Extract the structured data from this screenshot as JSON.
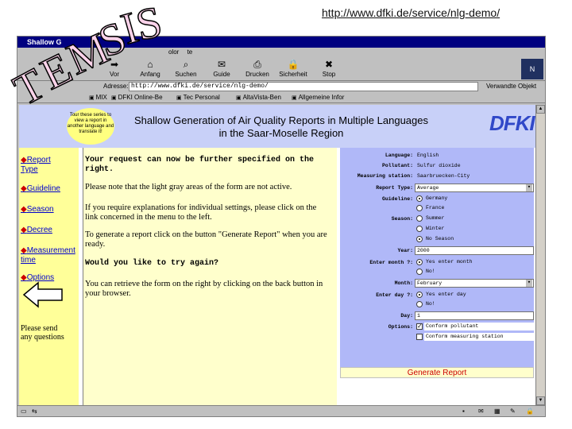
{
  "slide": {
    "url": "http://www.dfki.de/service/nlg-demo/",
    "logo_letters": [
      "T",
      "E",
      "M",
      "S",
      "I",
      "S"
    ]
  },
  "browser": {
    "title": "Shallow G",
    "menu": [
      "olor",
      "te"
    ],
    "toolbar": [
      {
        "label": "Vor",
        "icon": "forward-icon"
      },
      {
        "label": "Anfang",
        "icon": "home-icon"
      },
      {
        "label": "Suchen",
        "icon": "search-icon"
      },
      {
        "label": "Guide",
        "icon": "guide-icon"
      },
      {
        "label": "Drucken",
        "icon": "print-icon"
      },
      {
        "label": "Sicherheit",
        "icon": "security-icon"
      },
      {
        "label": "Stop",
        "icon": "stop-icon"
      }
    ],
    "logo": "N",
    "address_label": "Adresse:",
    "address_value": "http://www.dfki.de/service/nlg-demo/",
    "address_extra": "Verwandte Objekt",
    "links": [
      "MIX",
      "DFKI Online-Be",
      "Tec Personal",
      "AltaVista-Ben",
      "Allgemeine Infor"
    ]
  },
  "banner": {
    "bubble_text": "Tour these series to view a report in another language and translate it!",
    "title_line1": "Shallow Generation of Air Quality Reports in Multiple Languages",
    "title_line2": "in the Saar-Moselle Region",
    "logo": "DFKI"
  },
  "nav": {
    "items": [
      "Report Type",
      "Guideline",
      "Season",
      "Decree",
      "Measurement time",
      "Options"
    ],
    "note": "Please send any questions"
  },
  "middle": {
    "p1": "Your request can now be further specified on the right.",
    "p2": "Please note that the light gray areas of the form are not active.",
    "p3": "If you require explanations for individual settings, please click on the link concerned in the menu to the left.",
    "p4": "To generate a report click on the button \"Generate Report\" when you are ready.",
    "p5": "Would you like to try again?",
    "p6": "You can retrieve the form on the right by clicking on the back button in your browser."
  },
  "form": {
    "language_label": "Language:",
    "language_value": "English",
    "pollutant_label": "Pollutant:",
    "pollutant_value": "Sulfur dioxide",
    "station_label": "Measuring station:",
    "station_value": "Saarbruecken-City",
    "report_type_label": "Report Type:",
    "report_type_value": "Average",
    "guideline_label": "Guideline:",
    "guideline_options": [
      "Germany",
      "France"
    ],
    "season_label": "Season:",
    "season_options": [
      "Summer",
      "Winter",
      "No Season"
    ],
    "year_label": "Year:",
    "year_value": "2000",
    "month_label": "Enter month ?:",
    "month_options": [
      "Yes  enter month",
      "No!"
    ],
    "month_value_label": "Month:",
    "month_value": "February",
    "day_label": "Enter day ?:",
    "day_options": [
      "Yes  enter day",
      "No!"
    ],
    "day_value_label": "Day:",
    "day_value": "1",
    "options_label": "Options:",
    "option1": "Conform pollutant",
    "option2": "Conform measuring station",
    "generate_label": "Generate Report"
  }
}
